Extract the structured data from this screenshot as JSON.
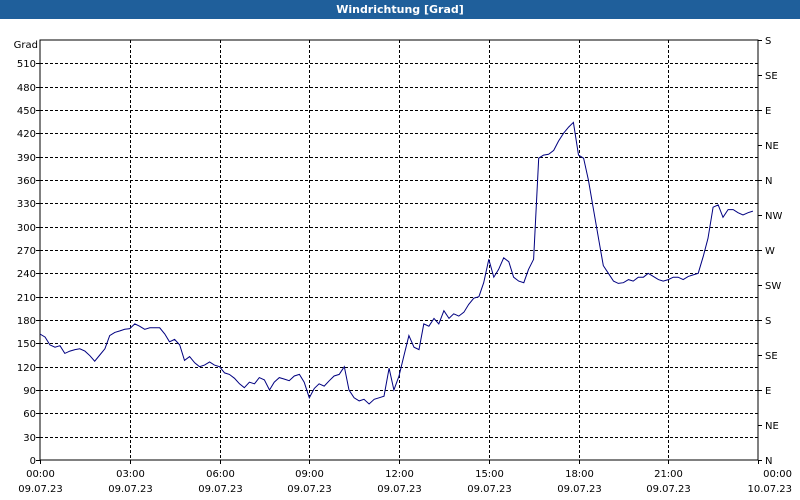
{
  "chart_data": {
    "type": "line",
    "title": "Windrichtung [Grad]",
    "ylabel": "Grad",
    "ylim": [
      0,
      540
    ],
    "y_ticks": [
      0,
      30,
      60,
      90,
      120,
      150,
      180,
      210,
      240,
      270,
      300,
      330,
      360,
      390,
      420,
      450,
      480,
      510
    ],
    "right_axis_labels": [
      {
        "value": 0,
        "label": "N"
      },
      {
        "value": 45,
        "label": "NE"
      },
      {
        "value": 90,
        "label": "E"
      },
      {
        "value": 135,
        "label": "SE"
      },
      {
        "value": 180,
        "label": "S"
      },
      {
        "value": 225,
        "label": "SW"
      },
      {
        "value": 270,
        "label": "W"
      },
      {
        "value": 315,
        "label": "NW"
      },
      {
        "value": 360,
        "label": "N"
      },
      {
        "value": 405,
        "label": "NE"
      },
      {
        "value": 450,
        "label": "E"
      },
      {
        "value": 495,
        "label": "SE"
      },
      {
        "value": 540,
        "label": "S"
      }
    ],
    "x_ticks": [
      {
        "time": "00:00",
        "date": "09.07.23"
      },
      {
        "time": "03:00",
        "date": "09.07.23"
      },
      {
        "time": "06:00",
        "date": "09.07.23"
      },
      {
        "time": "09:00",
        "date": "09.07.23"
      },
      {
        "time": "12:00",
        "date": "09.07.23"
      },
      {
        "time": "15:00",
        "date": "09.07.23"
      },
      {
        "time": "18:00",
        "date": "09.07.23"
      },
      {
        "time": "21:00",
        "date": "09.07.23"
      },
      {
        "time": "00:00",
        "date": "10.07.23"
      }
    ],
    "grid": true,
    "line_color": "#000080",
    "series": [
      {
        "x_hours": [
          0,
          0.17,
          0.33,
          0.5,
          0.67,
          0.83,
          1.0,
          1.17,
          1.33,
          1.5,
          1.67,
          1.83,
          2.0,
          2.17,
          2.33,
          2.5,
          2.67,
          2.83,
          3.0,
          3.17,
          3.33,
          3.5,
          3.67,
          3.83,
          4.0,
          4.17,
          4.33,
          4.5,
          4.67,
          4.83,
          5.0,
          5.17,
          5.33,
          5.5,
          5.67,
          5.83,
          6.0,
          6.17,
          6.33,
          6.5,
          6.67,
          6.83,
          7.0,
          7.17,
          7.33,
          7.5,
          7.67,
          7.83,
          8.0,
          8.17,
          8.33,
          8.5,
          8.67,
          8.83,
          9.0,
          9.17,
          9.33,
          9.5,
          9.67,
          9.83,
          10.0,
          10.17,
          10.33,
          10.5,
          10.67,
          10.83,
          11.0,
          11.17,
          11.33,
          11.5,
          11.67,
          11.83,
          12.0,
          12.17,
          12.33,
          12.5,
          12.67,
          12.83,
          13.0,
          13.17,
          13.33,
          13.5,
          13.67,
          13.83,
          14.0,
          14.17,
          14.33,
          14.5,
          14.67,
          14.83,
          15.0,
          15.17,
          15.33,
          15.5,
          15.67,
          15.83,
          16.0,
          16.17,
          16.33,
          16.5,
          16.67,
          16.83,
          17.0,
          17.17,
          17.33,
          17.5,
          17.67,
          17.83,
          18.0,
          18.17,
          18.33,
          18.5,
          18.67,
          18.83,
          19.0,
          19.17,
          19.33,
          19.5,
          19.67,
          19.83,
          20.0,
          20.17,
          20.33,
          20.5,
          20.67,
          20.83,
          21.0,
          21.17,
          21.33,
          21.5,
          21.67,
          21.83,
          22.0,
          22.17,
          22.33,
          22.5,
          22.67,
          22.83,
          23.0,
          23.17,
          23.33,
          23.5,
          23.67,
          23.83,
          24.0
        ],
        "values": [
          162,
          158,
          148,
          145,
          147,
          137,
          140,
          142,
          143,
          140,
          134,
          127,
          135,
          143,
          160,
          164,
          166,
          168,
          169,
          175,
          172,
          168,
          170,
          170,
          170,
          162,
          152,
          155,
          148,
          128,
          133,
          125,
          120,
          122,
          126,
          122,
          120,
          112,
          110,
          105,
          98,
          93,
          100,
          98,
          106,
          103,
          90,
          100,
          106,
          104,
          102,
          108,
          110,
          100,
          80,
          92,
          98,
          95,
          102,
          108,
          110,
          120,
          90,
          80,
          76,
          78,
          72,
          78,
          80,
          82,
          118,
          90,
          108,
          135,
          160,
          145,
          142,
          175,
          172,
          182,
          175,
          192,
          182,
          188,
          185,
          190,
          200,
          208,
          210,
          228,
          258,
          235,
          245,
          260,
          255,
          235,
          230,
          228,
          245,
          258,
          388,
          392,
          393,
          398,
          410,
          420,
          428,
          434,
          392,
          388,
          360,
          322,
          285,
          250,
          240,
          230,
          227,
          228,
          232,
          230,
          235,
          235,
          240,
          236,
          232,
          230,
          232,
          235,
          235,
          232,
          236,
          238,
          240,
          262,
          285,
          325,
          328,
          312,
          322,
          322,
          318,
          315,
          318,
          320
        ]
      }
    ]
  }
}
